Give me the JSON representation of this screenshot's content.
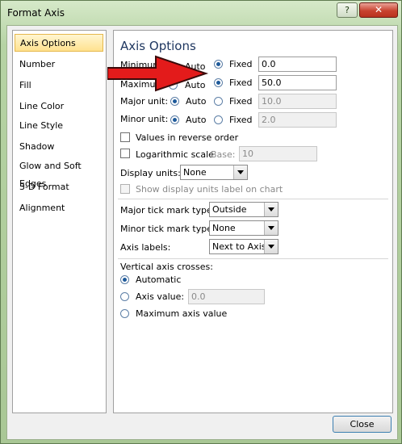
{
  "window": {
    "title": "Format Axis",
    "help_label": "?",
    "close_label": "✕"
  },
  "nav": {
    "items": [
      {
        "label": "Axis Options",
        "active": true
      },
      {
        "label": "Number"
      },
      {
        "label": "Fill"
      },
      {
        "label": "Line Color"
      },
      {
        "label": "Line Style"
      },
      {
        "label": "Shadow"
      },
      {
        "label": "Glow and Soft Edges"
      },
      {
        "label": "3-D Format"
      },
      {
        "label": "Alignment"
      }
    ]
  },
  "panel": {
    "heading": "Axis Options",
    "rows": {
      "minimum": {
        "label": "Minimum:",
        "auto_label": "Auto",
        "fixed_label": "Fixed",
        "value": "0.0",
        "selected": "fixed"
      },
      "maximum": {
        "label": "Maximum:",
        "auto_label": "Auto",
        "fixed_label": "Fixed",
        "value": "50.0",
        "selected": "fixed"
      },
      "major_unit": {
        "label": "Major unit:",
        "auto_label": "Auto",
        "fixed_label": "Fixed",
        "value": "10.0",
        "selected": "auto"
      },
      "minor_unit": {
        "label": "Minor unit:",
        "auto_label": "Auto",
        "fixed_label": "Fixed",
        "value": "2.0",
        "selected": "auto"
      }
    },
    "reverse_order": {
      "label": "Values in reverse order",
      "checked": false
    },
    "log_scale": {
      "label": "Logarithmic scale",
      "base_label": "Base:",
      "base_value": "10",
      "checked": false
    },
    "display_units": {
      "label": "Display units:",
      "value": "None"
    },
    "show_units_label": {
      "label": "Show display units label on chart",
      "checked": false
    },
    "major_tick": {
      "label": "Major tick mark type:",
      "value": "Outside"
    },
    "minor_tick": {
      "label": "Minor tick mark type:",
      "value": "None"
    },
    "axis_labels": {
      "label": "Axis labels:",
      "value": "Next to Axis"
    },
    "crosses": {
      "label": "Vertical axis crosses:",
      "automatic_label": "Automatic",
      "axis_value_label": "Axis value:",
      "axis_value": "0.0",
      "maximum_label": "Maximum axis value",
      "selected": "automatic"
    }
  },
  "footer": {
    "close_label": "Close"
  },
  "overlay": {
    "arrow_color": "#e31b1b"
  }
}
